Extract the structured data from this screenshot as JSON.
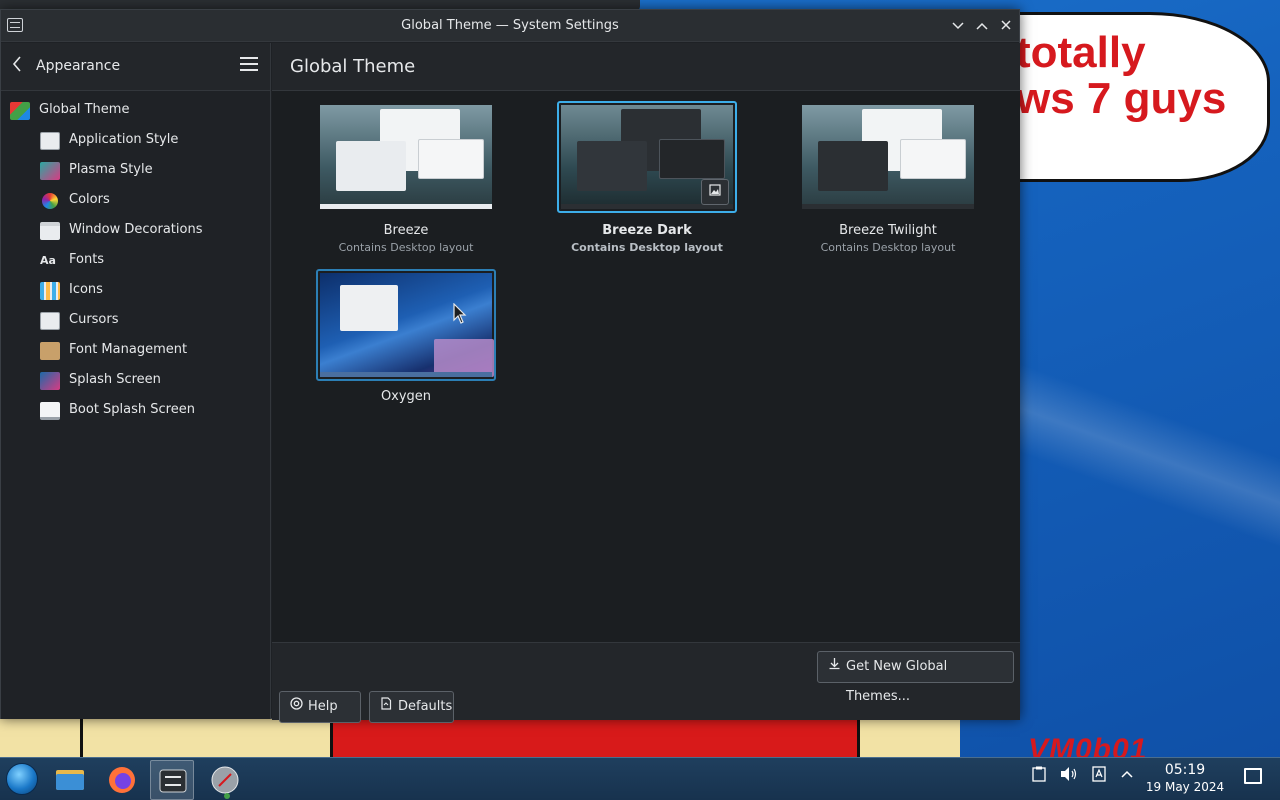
{
  "window": {
    "title": "Global Theme — System Settings"
  },
  "sidebar": {
    "back_label": "Appearance",
    "items": [
      {
        "label": "Global Theme",
        "icon": "global-theme-icon",
        "level": "top"
      },
      {
        "label": "Application Style",
        "icon": "application-style-icon",
        "level": "sub"
      },
      {
        "label": "Plasma Style",
        "icon": "plasma-style-icon",
        "level": "sub"
      },
      {
        "label": "Colors",
        "icon": "colors-icon",
        "level": "sub"
      },
      {
        "label": "Window Decorations",
        "icon": "window-decorations-icon",
        "level": "sub"
      },
      {
        "label": "Fonts",
        "icon": "fonts-icon",
        "level": "sub"
      },
      {
        "label": "Icons",
        "icon": "icons-icon",
        "level": "sub"
      },
      {
        "label": "Cursors",
        "icon": "cursors-icon",
        "level": "sub"
      },
      {
        "label": "Font Management",
        "icon": "font-management-icon",
        "level": "sub"
      },
      {
        "label": "Splash Screen",
        "icon": "splash-screen-icon",
        "level": "sub"
      },
      {
        "label": "Boot Splash Screen",
        "icon": "boot-splash-screen-icon",
        "level": "sub"
      }
    ]
  },
  "main": {
    "title": "Global Theme",
    "themes": [
      {
        "name": "Breeze",
        "description": "Contains Desktop layout",
        "selected": false
      },
      {
        "name": "Breeze Dark",
        "description": "Contains Desktop layout",
        "selected": true
      },
      {
        "name": "Breeze Twilight",
        "description": "Contains Desktop layout",
        "selected": false
      },
      {
        "name": "Oxygen",
        "description": "",
        "selected": false
      }
    ]
  },
  "footer": {
    "get_new_label": "Get New Global Themes...",
    "help_label": "Help",
    "defaults_label": "Defaults"
  },
  "desktop": {
    "bubble_text": "totally\nws 7 guys",
    "vm_label": "VM0b01"
  },
  "taskbar": {
    "time": "05:19",
    "date": "19 May 2024"
  },
  "colors": {
    "accent": "#3daee9",
    "window_bg": "#1e2125",
    "sidebar_bg": "#1f2226"
  }
}
